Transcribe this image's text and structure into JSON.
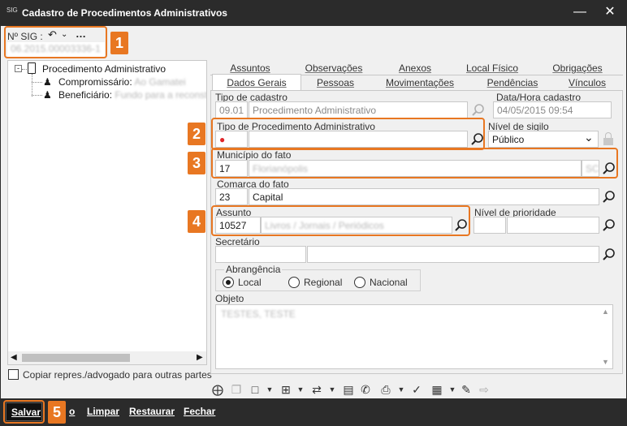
{
  "window": {
    "title": "Cadastro de Procedimentos Administrativos",
    "app_icon": "SIG"
  },
  "header": {
    "sig_label": "Nº SIG :",
    "sig_value": "06.2015.00003336-1"
  },
  "tree": {
    "root": "Procedimento Administrativo",
    "items": [
      {
        "label": "Compromissário:",
        "value": "Ao Gamatei"
      },
      {
        "label": "Beneficiário:",
        "value": "Fundo para a reconstit"
      }
    ]
  },
  "copy_checkbox": "Copiar repres./advogado para outras partes",
  "tabs_top": [
    "Assuntos",
    "Observações",
    "Anexos",
    "Local Físico",
    "Obrigações"
  ],
  "tabs_bottom": [
    "Dados Gerais",
    "Pessoas",
    "Movimentações",
    "Pendências",
    "Vínculos"
  ],
  "form": {
    "tipo_cadastro_label": "Tipo de cadastro",
    "tipo_cadastro_code": "09.01",
    "tipo_cadastro_value": "Procedimento Administrativo",
    "data_label": "Data/Hora cadastro",
    "data_value": "04/05/2015 09:54",
    "tipo_proc_label": "Tipo de Procedimento Administrativo",
    "sigilo_label": "Nível de sigilo",
    "sigilo_value": "Público",
    "municipio_label": "Município do fato",
    "municipio_code": "17",
    "municipio_value": "Florianópolis",
    "municipio_uf": "SC",
    "comarca_label": "Comarca do fato",
    "comarca_code": "23",
    "comarca_value": "Capital",
    "assunto_label": "Assunto",
    "assunto_code": "10527",
    "assunto_value": "Livros / Jornais / Periódicos",
    "prioridade_label": "Nível de prioridade",
    "secretario_label": "Secretário",
    "abrangencia_label": "Abrangência",
    "abrangencia_options": [
      "Local",
      "Regional",
      "Nacional"
    ],
    "objeto_label": "Objeto",
    "objeto_value": "TESTES, TESTE"
  },
  "badges": [
    "1",
    "2",
    "3",
    "4",
    "5"
  ],
  "bottom_buttons": [
    "Salvar",
    "o",
    "Limpar",
    "Restaurar",
    "Fechar"
  ],
  "accent_color": "#e87722"
}
